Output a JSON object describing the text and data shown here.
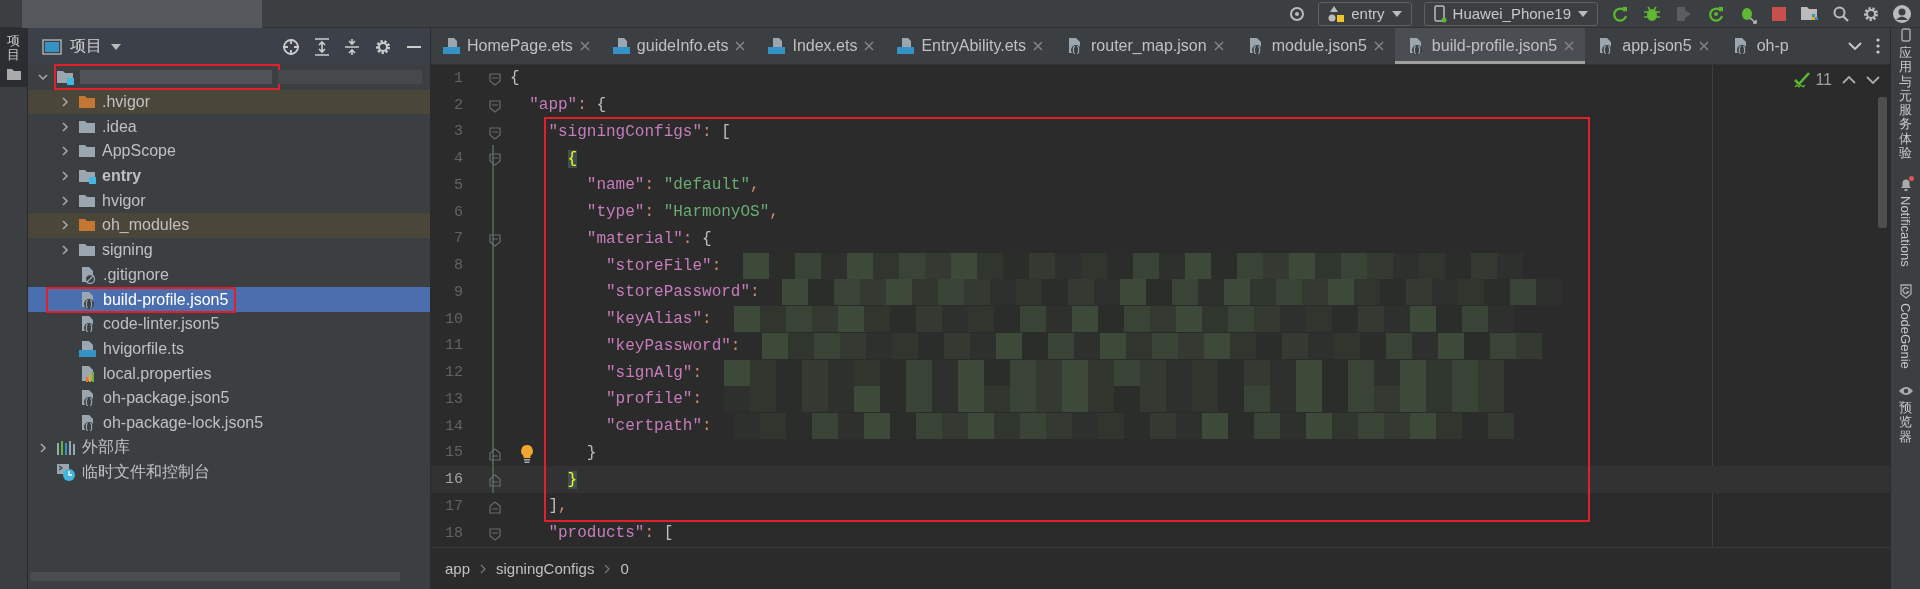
{
  "toolbar": {
    "run_config": "entry",
    "device": "Huawei_Phone19"
  },
  "side_strip": {
    "label": "项目",
    "selected": true
  },
  "project_panel": {
    "title": "项目",
    "tree": [
      {
        "kind": "project-root",
        "expanded": true,
        "selected": false,
        "boxed": true,
        "children": [
          {
            "kind": "excluded-folder",
            "label": ".hvigor",
            "expanded": false,
            "selected": false,
            "boxed": false
          },
          {
            "kind": "folder",
            "label": ".idea",
            "expanded": false,
            "selected": false,
            "boxed": false
          },
          {
            "kind": "folder",
            "label": "AppScope",
            "expanded": false,
            "selected": false,
            "boxed": false
          },
          {
            "kind": "module-folder",
            "label": "entry",
            "expanded": false,
            "selected": false,
            "boxed": false
          },
          {
            "kind": "folder",
            "label": "hvigor",
            "expanded": false,
            "selected": false,
            "boxed": false
          },
          {
            "kind": "excluded-folder",
            "label": "oh_modules",
            "expanded": false,
            "selected": false,
            "boxed": false
          },
          {
            "kind": "folder",
            "label": "signing",
            "expanded": false,
            "selected": false,
            "boxed": false
          },
          {
            "kind": "ignore-file",
            "label": ".gitignore",
            "selected": false,
            "boxed": false
          },
          {
            "kind": "json-file",
            "label": "build-profile.json5",
            "selected": true,
            "boxed": true
          },
          {
            "kind": "json-file",
            "label": "code-linter.json5",
            "selected": false,
            "boxed": false
          },
          {
            "kind": "ts-file",
            "label": "hvigorfile.ts",
            "selected": false,
            "boxed": false
          },
          {
            "kind": "properties-file",
            "label": "local.properties",
            "selected": false,
            "boxed": false
          },
          {
            "kind": "json-file",
            "label": "oh-package.json5",
            "selected": false,
            "boxed": false
          },
          {
            "kind": "json-file",
            "label": "oh-package-lock.json5",
            "selected": false,
            "boxed": false
          }
        ]
      },
      {
        "kind": "library",
        "label": "外部库",
        "expanded": false,
        "selected": false,
        "boxed": false
      },
      {
        "kind": "scratches",
        "label": "临时文件和控制台",
        "selected": false,
        "boxed": false
      }
    ]
  },
  "tabs": [
    {
      "kind": "ets",
      "label": "HomePage.ets",
      "selected": false
    },
    {
      "kind": "ets",
      "label": "guideInfo.ets",
      "selected": false
    },
    {
      "kind": "ets",
      "label": "Index.ets",
      "selected": false
    },
    {
      "kind": "ets",
      "label": "EntryAbility.ets",
      "selected": false
    },
    {
      "kind": "json",
      "label": "router_map.json",
      "selected": false
    },
    {
      "kind": "json",
      "label": "module.json5",
      "selected": false
    },
    {
      "kind": "json",
      "label": "build-profile.json5",
      "selected": true
    },
    {
      "kind": "json",
      "label": "app.json5",
      "selected": false
    },
    {
      "kind": "json",
      "label": "oh-p",
      "selected": false
    }
  ],
  "editor": {
    "inspection_count": "11",
    "blocks": [
      {
        "boxed": false,
        "lines": [
          {
            "number": "1",
            "fold": {
              "kind": "start"
            },
            "changed": false,
            "current": false,
            "tokens": [
              {
                "kind": "punct",
                "text": "{"
              }
            ]
          },
          {
            "number": "2",
            "fold": {
              "kind": "start"
            },
            "changed": false,
            "current": false,
            "tokens": [
              {
                "kind": "key",
                "text": "  \"app\""
              },
              {
                "kind": "sep",
                "text": ": "
              },
              {
                "kind": "punct",
                "text": "{"
              }
            ]
          }
        ]
      },
      {
        "boxed": true,
        "lines": [
          {
            "number": "3",
            "fold": {
              "kind": "start"
            },
            "changed": false,
            "current": false,
            "tokens": [
              {
                "kind": "key",
                "text": "    \"signingConfigs\""
              },
              {
                "kind": "sep",
                "text": ": "
              },
              {
                "kind": "punct",
                "text": "["
              }
            ]
          },
          {
            "number": "4",
            "fold": {
              "kind": "start"
            },
            "changed": true,
            "current": false,
            "tokens": [
              {
                "kind": "brace-match",
                "text": "      {"
              }
            ]
          },
          {
            "number": "5",
            "changed": true,
            "current": false,
            "tokens": [
              {
                "kind": "key",
                "text": "        \"name\""
              },
              {
                "kind": "sep",
                "text": ": "
              },
              {
                "kind": "string",
                "text": "\"default\""
              },
              {
                "kind": "sep",
                "text": ","
              }
            ]
          },
          {
            "number": "6",
            "changed": true,
            "current": false,
            "tokens": [
              {
                "kind": "key",
                "text": "        \"type\""
              },
              {
                "kind": "sep",
                "text": ": "
              },
              {
                "kind": "string",
                "text": "\"HarmonyOS\""
              },
              {
                "kind": "sep",
                "text": ","
              }
            ]
          },
          {
            "number": "7",
            "fold": {
              "kind": "start"
            },
            "changed": true,
            "current": false,
            "tokens": [
              {
                "kind": "key",
                "text": "        \"material\""
              },
              {
                "kind": "sep",
                "text": ": "
              },
              {
                "kind": "punct",
                "text": "{"
              }
            ]
          },
          {
            "number": "8",
            "changed": true,
            "current": false,
            "value": {
              "kind": "redacted"
            },
            "tokens": [
              {
                "kind": "key",
                "text": "          \"storeFile\""
              },
              {
                "kind": "sep",
                "text": ":"
              }
            ]
          },
          {
            "number": "9",
            "changed": true,
            "current": false,
            "value": {
              "kind": "redacted"
            },
            "tokens": [
              {
                "kind": "key",
                "text": "          \"storePassword\""
              },
              {
                "kind": "sep",
                "text": ":"
              }
            ]
          },
          {
            "number": "10",
            "changed": true,
            "current": false,
            "value": {
              "kind": "redacted"
            },
            "tokens": [
              {
                "kind": "key",
                "text": "          \"keyAlias\""
              },
              {
                "kind": "sep",
                "text": ":"
              }
            ]
          },
          {
            "number": "11",
            "changed": true,
            "current": false,
            "value": {
              "kind": "redacted"
            },
            "tokens": [
              {
                "kind": "key",
                "text": "          \"keyPassword\""
              },
              {
                "kind": "sep",
                "text": ":"
              }
            ]
          },
          {
            "number": "12",
            "changed": true,
            "current": false,
            "value": {
              "kind": "redacted"
            },
            "tokens": [
              {
                "kind": "key",
                "text": "          \"signAlg\""
              },
              {
                "kind": "sep",
                "text": ":"
              }
            ]
          },
          {
            "number": "13",
            "changed": true,
            "current": false,
            "value": {
              "kind": "redacted"
            },
            "tokens": [
              {
                "kind": "key",
                "text": "          \"profile\""
              },
              {
                "kind": "sep",
                "text": ":"
              }
            ]
          },
          {
            "number": "14",
            "changed": true,
            "current": false,
            "value": {
              "kind": "redacted"
            },
            "tokens": [
              {
                "kind": "key",
                "text": "          \"certpath\""
              },
              {
                "kind": "sep",
                "text": ":"
              }
            ]
          },
          {
            "number": "15",
            "fold": {
              "kind": "end"
            },
            "gutter_icon": {
              "kind": "lightbulb"
            },
            "changed": true,
            "current": false,
            "tokens": [
              {
                "kind": "punct",
                "text": "        }"
              }
            ]
          },
          {
            "number": "16",
            "fold": {
              "kind": "end"
            },
            "changed": true,
            "current": true,
            "tokens": [
              {
                "kind": "brace-match",
                "text": "      }"
              }
            ]
          },
          {
            "number": "17",
            "fold": {
              "kind": "end"
            },
            "changed": false,
            "current": false,
            "tokens": [
              {
                "kind": "punct",
                "text": "    ]"
              },
              {
                "kind": "sep",
                "text": ","
              }
            ]
          }
        ]
      },
      {
        "boxed": false,
        "lines": [
          {
            "number": "18",
            "fold": {
              "kind": "start"
            },
            "changed": false,
            "current": false,
            "tokens": [
              {
                "kind": "key",
                "text": "    \"products\""
              },
              {
                "kind": "sep",
                "text": ": "
              },
              {
                "kind": "punct",
                "text": "["
              }
            ]
          }
        ]
      }
    ]
  },
  "breadcrumb": [
    "app",
    "signingConfigs",
    "0"
  ],
  "right_strip": [
    {
      "kind": "app-service",
      "label": "应用与元服务体验",
      "alert": false
    },
    {
      "kind": "notifications",
      "label": "Notifications",
      "alert": true
    },
    {
      "kind": "codegenie",
      "label": "CodeGenie",
      "alert": false
    },
    {
      "kind": "previewer",
      "label": "预览器",
      "alert": false
    }
  ]
}
